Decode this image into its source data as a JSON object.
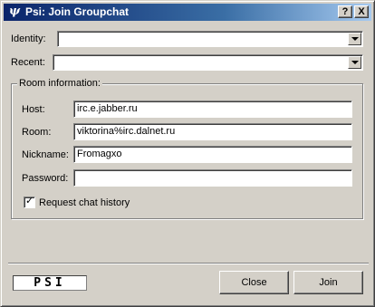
{
  "window": {
    "title": "Psi: Join Groupchat",
    "icon_glyph": "ψ",
    "help_glyph": "?",
    "close_glyph": "X"
  },
  "identity": {
    "label": "Identity:",
    "value": ""
  },
  "recent": {
    "label": "Recent:",
    "value": ""
  },
  "room_info": {
    "title": "Room information:",
    "host": {
      "label": "Host:",
      "value": "irc.e.jabber.ru"
    },
    "room": {
      "label": "Room:",
      "value": "viktorina%irc.dalnet.ru"
    },
    "nickname": {
      "label": "Nickname:",
      "value": "Fromagxo"
    },
    "password": {
      "label": "Password:",
      "value": ""
    },
    "history": {
      "label": "Request chat history",
      "checked": true,
      "check_glyph": "✓"
    }
  },
  "footer": {
    "logo_text": "PSI",
    "close_label": "Close",
    "join_label": "Join"
  },
  "colors": {
    "titlebar_start": "#0a246a",
    "titlebar_end": "#a6caf0",
    "face": "#d4d0c8"
  }
}
